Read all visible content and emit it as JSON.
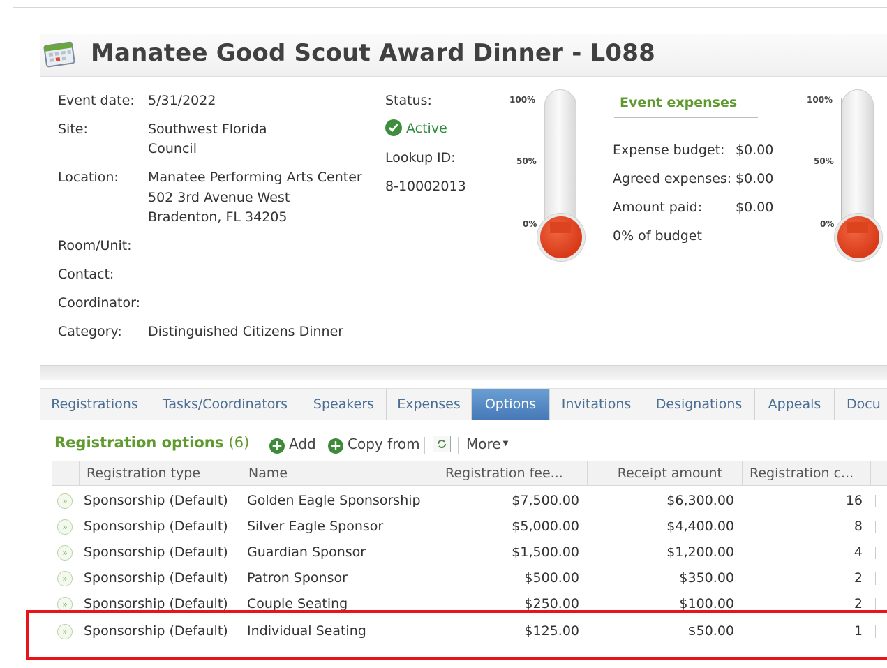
{
  "header": {
    "title": "Manatee Good Scout Award Dinner - L088",
    "icon": "calendar-icon"
  },
  "details": {
    "event_date_label": "Event date:",
    "event_date": "5/31/2022",
    "site_label": "Site:",
    "site_line1": "Southwest Florida",
    "site_line2": "Council",
    "location_label": "Location:",
    "location_line1": "Manatee Performing Arts Center",
    "location_line2": "502 3rd Avenue West",
    "location_line3": "Bradenton, FL  34205",
    "room_label": "Room/Unit:",
    "contact_label": "Contact:",
    "coordinator_label": "Coordinator:",
    "category_label": "Category:",
    "category": "Distinguished Citizens Dinner",
    "status_label": "Status:",
    "status": "Active",
    "lookup_label": "Lookup ID:",
    "lookup_id": "8-10002013"
  },
  "thermometer": {
    "p100": "100%",
    "p50": "50%",
    "p0": "0%",
    "level": 0
  },
  "expenses": {
    "title": "Event expenses",
    "budget_label": "Expense budget:",
    "budget": "$0.00",
    "agreed_label": "Agreed expenses:",
    "agreed": "$0.00",
    "paid_label": "Amount paid:",
    "paid": "$0.00",
    "of_budget": "0% of budget"
  },
  "tabs": [
    "Registrations",
    "Tasks/Coordinators",
    "Speakers",
    "Expenses",
    "Options",
    "Invitations",
    "Designations",
    "Appeals",
    "Docu"
  ],
  "selected_tab": "Options",
  "section": {
    "title": "Registration options",
    "count": "(6)",
    "add": "Add",
    "copy_from": "Copy from",
    "more": "More"
  },
  "grid": {
    "columns": [
      "Registration type",
      "Name",
      "Registration fee...",
      "Receipt amount",
      "Registration c..."
    ],
    "rows": [
      {
        "type": "Sponsorship (Default)",
        "name": "Golden Eagle Sponsorship",
        "fee": "$7,500.00",
        "receipt": "$6,300.00",
        "count": "16"
      },
      {
        "type": "Sponsorship (Default)",
        "name": "Silver Eagle Sponsor",
        "fee": "$5,000.00",
        "receipt": "$4,400.00",
        "count": "8"
      },
      {
        "type": "Sponsorship (Default)",
        "name": "Guardian Sponsor",
        "fee": "$1,500.00",
        "receipt": "$1,200.00",
        "count": "4"
      },
      {
        "type": "Sponsorship (Default)",
        "name": "Patron Sponsor",
        "fee": "$500.00",
        "receipt": "$350.00",
        "count": "2"
      },
      {
        "type": "Sponsorship (Default)",
        "name": "Couple Seating",
        "fee": "$250.00",
        "receipt": "$100.00",
        "count": "2"
      },
      {
        "type": "Sponsorship (Default)",
        "name": "Individual Seating",
        "fee": "$125.00",
        "receipt": "$50.00",
        "count": "1"
      }
    ]
  },
  "colors": {
    "accent_green": "#5f9a2f",
    "tab_selected": "#4679b8",
    "highlight": "#e8141b",
    "thermo_red": "#dc4420"
  }
}
